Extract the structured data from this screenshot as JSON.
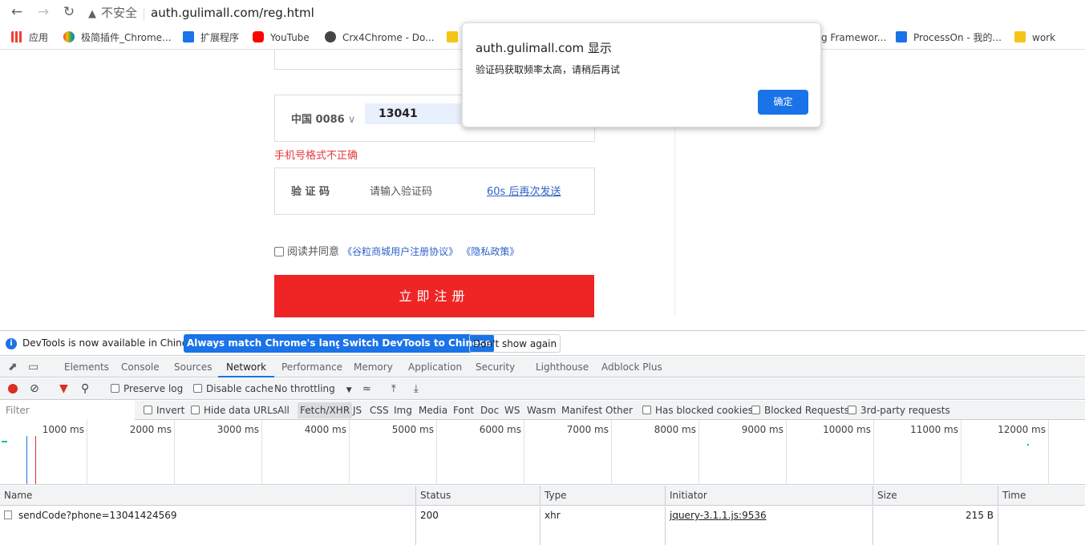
{
  "browser": {
    "security_label": "不安全",
    "url": "auth.gulimall.com/reg.html"
  },
  "bookmarks": [
    {
      "label": "应用",
      "color": "#ea4335"
    },
    {
      "label": "极简插件_Chrome...",
      "color": "#fbbc05"
    },
    {
      "label": "扩展程序",
      "color": "#1a73e8"
    },
    {
      "label": "YouTube",
      "color": "#ff0000"
    },
    {
      "label": "Crx4Chrome - Do...",
      "color": "#444444"
    },
    {
      "label": "g Framewor...",
      "color": "#555555"
    },
    {
      "label": "ProcessOn - 我的...",
      "color": "#1a73e8"
    },
    {
      "label": "work",
      "color": "#f5c518"
    }
  ],
  "form": {
    "country_code": "中国 0086",
    "phone_value": "13041",
    "phone_error": "手机号格式不正确",
    "code_label": "验 证 码",
    "code_placeholder": "请输入验证码",
    "resend_label": "60s 后再次发送",
    "agree_text": "阅读并同意",
    "agreement_link": "《谷粒商城用户注册协议》",
    "privacy_link": "《隐私政策》",
    "register_button": "立即注册"
  },
  "alert": {
    "title": "auth.gulimall.com 显示",
    "message": "验证码获取频率太高，请稍后再试",
    "ok_button": "确定"
  },
  "devtools": {
    "infobar_text": "DevTools is now available in Chinese!",
    "btn_match": "Always match Chrome's language",
    "btn_switch": "Switch DevTools to Chinese",
    "btn_dont_show": "Don't show again",
    "tabs": [
      "Elements",
      "Console",
      "Sources",
      "Network",
      "Performance",
      "Memory",
      "Application",
      "Security",
      "Lighthouse",
      "Adblock Plus"
    ],
    "active_tab": "Network",
    "toolbar": {
      "preserve_log": "Preserve log",
      "disable_cache": "Disable cache",
      "throttling": "No throttling"
    },
    "filter": {
      "placeholder": "Filter",
      "invert": "Invert",
      "hide_data_urls": "Hide data URLs",
      "types": [
        "All",
        "Fetch/XHR",
        "JS",
        "CSS",
        "Img",
        "Media",
        "Font",
        "Doc",
        "WS",
        "Wasm",
        "Manifest",
        "Other"
      ],
      "selected_type": "Fetch/XHR",
      "has_blocked_cookies": "Has blocked cookies",
      "blocked_requests": "Blocked Requests",
      "third_party": "3rd-party requests"
    },
    "timeline_ticks": [
      "1000 ms",
      "2000 ms",
      "3000 ms",
      "4000 ms",
      "5000 ms",
      "6000 ms",
      "7000 ms",
      "8000 ms",
      "9000 ms",
      "10000 ms",
      "11000 ms",
      "12000 ms"
    ],
    "columns": [
      "Name",
      "Status",
      "Type",
      "Initiator",
      "Size",
      "Time"
    ],
    "rows": [
      {
        "name": "sendCode?phone=13041424569",
        "status": "200",
        "type": "xhr",
        "initiator": "jquery-3.1.1.js:9536",
        "size": "215 B",
        "time": ""
      }
    ]
  }
}
